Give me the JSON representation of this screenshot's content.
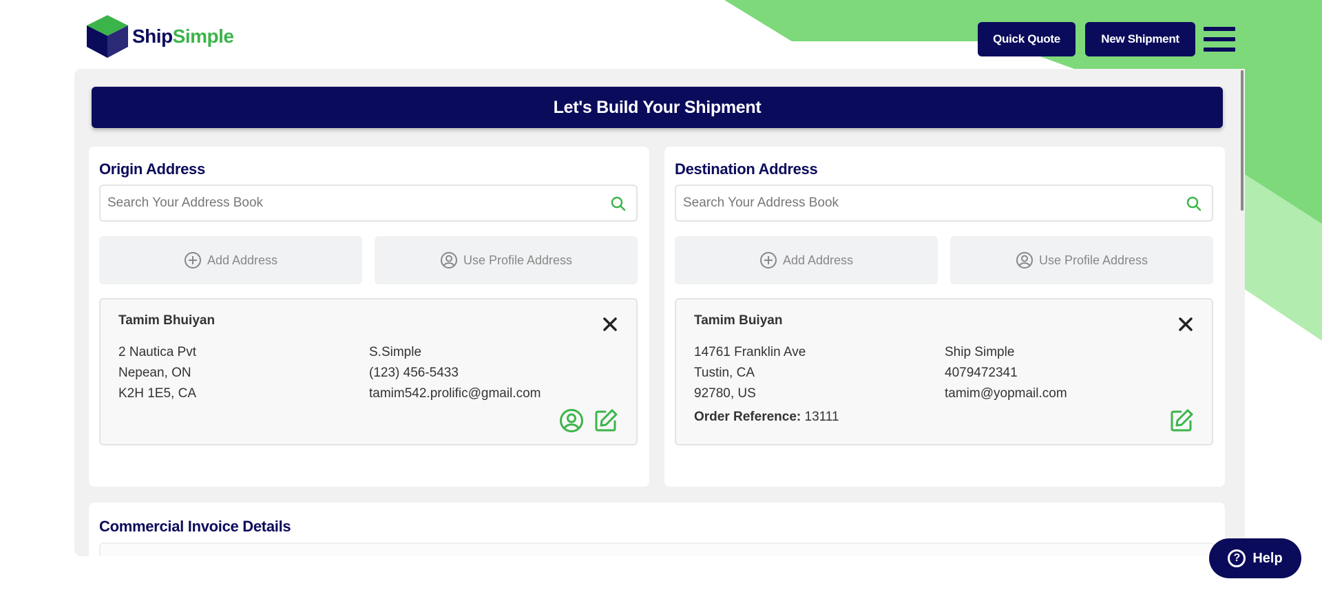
{
  "brand": {
    "name_part1": "Ship",
    "name_part2": "Simple"
  },
  "header": {
    "quick_quote_label": "Quick Quote",
    "new_shipment_label": "New Shipment"
  },
  "page": {
    "title": "Let's Build Your Shipment"
  },
  "origin": {
    "title": "Origin Address",
    "search_placeholder": "Search Your Address Book",
    "add_label": "Add Address",
    "profile_label": "Use Profile Address",
    "address": {
      "name": "Tamim Bhuiyan",
      "line1": "2 Nautica Pvt",
      "line2": "Nepean, ON",
      "line3": "K2H 1E5, CA",
      "company": "S.Simple",
      "phone": "(123) 456-5433",
      "email": "tamim542.prolific@gmail.com"
    }
  },
  "destination": {
    "title": "Destination Address",
    "search_placeholder": "Search Your Address Book",
    "add_label": "Add Address",
    "profile_label": "Use Profile Address",
    "address": {
      "name": "Tamim Buiyan",
      "line1": "14761 Franklin Ave",
      "line2": "Tustin, CA",
      "line3": "92780, US",
      "company": "Ship Simple",
      "phone": "4079472341",
      "email": "tamim@yopmail.com",
      "order_ref_label": "Order Reference:",
      "order_ref_value": "13111"
    }
  },
  "invoice": {
    "title": "Commercial Invoice Details"
  },
  "help": {
    "label": "Help"
  },
  "colors": {
    "navy": "#0b0b5c",
    "green": "#3bb54a",
    "light_green": "#7ed97b",
    "pale_green": "#b2ecaf"
  }
}
